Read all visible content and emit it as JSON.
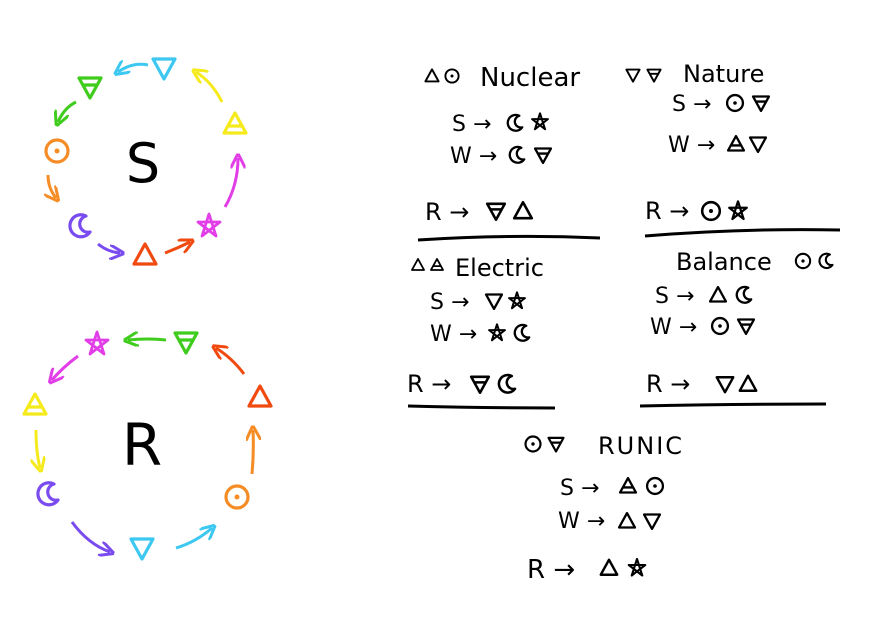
{
  "colors": {
    "red": "#f04a10",
    "orange": "#f68c26",
    "yellow": "#f5ea1c",
    "green": "#3fcc1c",
    "cyan": "#3cc8f0",
    "purple": "#7a4cf0",
    "magenta": "#e23ee8",
    "ink": "#000000"
  },
  "wheels": [
    {
      "id": "S",
      "label": "S",
      "symbols": [
        "green-earth-icon",
        "cyan-water-icon",
        "yellow-air-icon",
        "magenta-pentagram-icon",
        "red-fire-icon",
        "purple-moon-icon",
        "orange-sun-icon"
      ]
    },
    {
      "id": "R",
      "label": "R",
      "symbols": [
        "green-earth-icon",
        "magenta-pentagram-icon",
        "yellow-air-icon",
        "purple-moon-icon",
        "cyan-water-icon",
        "orange-sun-icon",
        "red-fire-icon"
      ]
    }
  ],
  "combos": {
    "nuclear": {
      "title": "Nuclear",
      "s": "S →",
      "w": "W →",
      "r": "R →"
    },
    "nature": {
      "title": "Nature",
      "s": "S →",
      "w": "W →",
      "r": "R →"
    },
    "electric": {
      "title": "Electric",
      "s": "S →",
      "w": "W →",
      "r": "R →"
    },
    "balance": {
      "title": "Balance",
      "s": "S →",
      "w": "W →",
      "r": "R →"
    },
    "runic": {
      "title": "RUNIC",
      "s": "S →",
      "w": "W →",
      "r": "R →"
    }
  }
}
